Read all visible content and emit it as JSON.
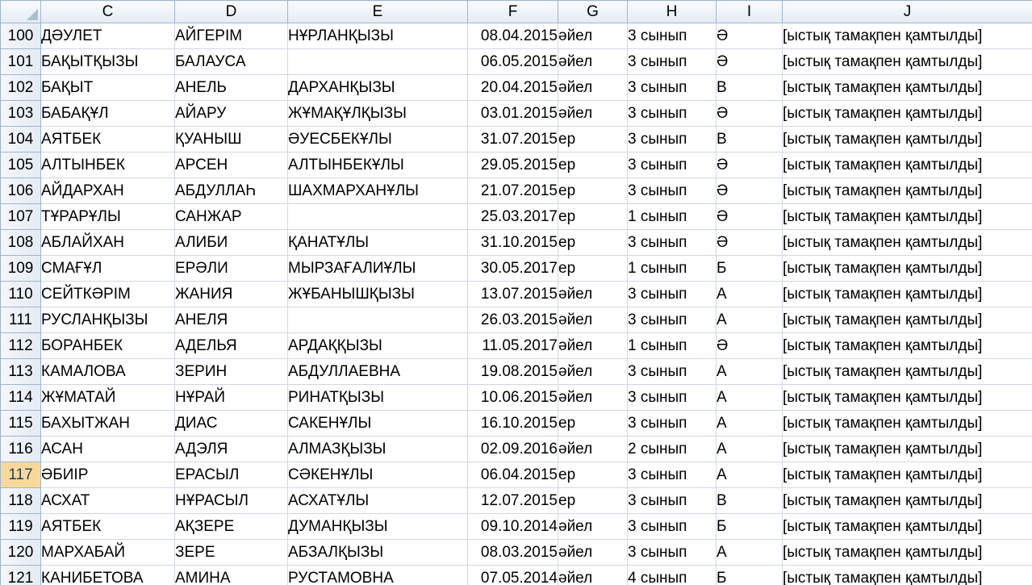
{
  "columns": [
    "C",
    "D",
    "E",
    "F",
    "G",
    "H",
    "I",
    "J"
  ],
  "active_row": "117",
  "rows": [
    {
      "n": "100",
      "c": "ДӘУЛЕТ",
      "d": "АЙГЕРІМ",
      "e": "НҰРЛАНҚЫЗЫ",
      "f": "08.04.2015",
      "g": "әйел",
      "h": "3 сынып",
      "i": "Ә",
      "j": "[ыстық тамақпен қамтылды]"
    },
    {
      "n": "101",
      "c": "БАҚЫТҚЫЗЫ",
      "d": "БАЛАУСА",
      "e": "",
      "f": "06.05.2015",
      "g": "әйел",
      "h": "3 сынып",
      "i": "Ә",
      "j": "[ыстық тамақпен қамтылды]"
    },
    {
      "n": "102",
      "c": "БАҚЫТ",
      "d": "АНЕЛЬ",
      "e": "ДАРХАНҚЫЗЫ",
      "f": "20.04.2015",
      "g": "әйел",
      "h": "3 сынып",
      "i": "В",
      "j": "[ыстық тамақпен қамтылды]"
    },
    {
      "n": "103",
      "c": "БАБАҚҰЛ",
      "d": "АЙАРУ",
      "e": "ЖҰМАҚҰЛҚЫЗЫ",
      "f": "03.01.2015",
      "g": "әйел",
      "h": "3 сынып",
      "i": "Ә",
      "j": "[ыстық тамақпен қамтылды]"
    },
    {
      "n": "104",
      "c": "АЯТБЕК",
      "d": "ҚУАНЫШ",
      "e": "ӘУЕСБЕКҰЛЫ",
      "f": "31.07.2015",
      "g": "ер",
      "h": "3 сынып",
      "i": "В",
      "j": "[ыстық тамақпен қамтылды]"
    },
    {
      "n": "105",
      "c": "АЛТЫНБЕК",
      "d": "АРСЕН",
      "e": "АЛТЫНБЕКҰЛЫ",
      "f": "29.05.2015",
      "g": "ер",
      "h": "3 сынып",
      "i": "Ә",
      "j": "[ыстық тамақпен қамтылды]"
    },
    {
      "n": "106",
      "c": "АЙДАРХАН",
      "d": "АБДУЛЛАҺ",
      "e": "ШАХМАРХАНҰЛЫ",
      "f": "21.07.2015",
      "g": "ер",
      "h": "3 сынып",
      "i": "Ә",
      "j": "[ыстық тамақпен қамтылды]"
    },
    {
      "n": "107",
      "c": "ТҰРАРҰЛЫ",
      "d": "САНЖАР",
      "e": "",
      "f": "25.03.2017",
      "g": "ер",
      "h": "1 сынып",
      "i": "Ә",
      "j": "[ыстық тамақпен қамтылды]"
    },
    {
      "n": "108",
      "c": "АБЛАЙХАН",
      "d": "АЛИБИ",
      "e": "ҚАНАТҰЛЫ",
      "f": "31.10.2015",
      "g": "ер",
      "h": "3 сынып",
      "i": "Ә",
      "j": "[ыстық тамақпен қамтылды]"
    },
    {
      "n": "109",
      "c": "СМАҒҰЛ",
      "d": "ЕРӘЛИ",
      "e": "МЫРЗАҒАЛИҰЛЫ",
      "f": "30.05.2017",
      "g": "ер",
      "h": "1 сынып",
      "i": "Б",
      "j": "[ыстық тамақпен қамтылды]"
    },
    {
      "n": "110",
      "c": "СЕЙТКӘРІМ",
      "d": "ЖАНИЯ",
      "e": "ЖҰБАНЫШҚЫЗЫ",
      "f": "13.07.2015",
      "g": "әйел",
      "h": "3 сынып",
      "i": "А",
      "j": "[ыстық тамақпен қамтылды]"
    },
    {
      "n": "111",
      "c": "РУСЛАНҚЫЗЫ",
      "d": "АНЕЛЯ",
      "e": "",
      "f": "26.03.2015",
      "g": "әйел",
      "h": "3 сынып",
      "i": "А",
      "j": "[ыстық тамақпен қамтылды]"
    },
    {
      "n": "112",
      "c": "БОРАНБЕК",
      "d": "АДЕЛЬЯ",
      "e": "АРДАҚҚЫЗЫ",
      "f": "11.05.2017",
      "g": "әйел",
      "h": "1 сынып",
      "i": "Ә",
      "j": "[ыстық тамақпен қамтылды]"
    },
    {
      "n": "113",
      "c": "КАМАЛОВА",
      "d": "ЗЕРИН",
      "e": "АБДУЛЛАЕВНА",
      "f": "19.08.2015",
      "g": "әйел",
      "h": "3 сынып",
      "i": "А",
      "j": "[ыстық тамақпен қамтылды]"
    },
    {
      "n": "114",
      "c": "ЖҰМАТАЙ",
      "d": "НҰРАЙ",
      "e": "РИНАТҚЫЗЫ",
      "f": "10.06.2015",
      "g": "әйел",
      "h": "3 сынып",
      "i": "А",
      "j": "[ыстық тамақпен қамтылды]"
    },
    {
      "n": "115",
      "c": "БАХЫТЖАН",
      "d": "ДИАС",
      "e": "САКЕНҰЛЫ",
      "f": "16.10.2015",
      "g": "ер",
      "h": "3 сынып",
      "i": "А",
      "j": "[ыстық тамақпен қамтылды]"
    },
    {
      "n": "116",
      "c": "АСАН",
      "d": "АДЭЛЯ",
      "e": "АЛМАЗҚЫЗЫ",
      "f": "02.09.2016",
      "g": "әйел",
      "h": "2 сынып",
      "i": "А",
      "j": "[ыстық тамақпен қамтылды]"
    },
    {
      "n": "117",
      "c": "ӘБИІР",
      "d": "ЕРАСЫЛ",
      "e": "СӘКЕНҰЛЫ",
      "f": "06.04.2015",
      "g": "ер",
      "h": "3 сынып",
      "i": "А",
      "j": "[ыстық тамақпен қамтылды]"
    },
    {
      "n": "118",
      "c": "АСХАТ",
      "d": "НҰРАСЫЛ",
      "e": "АСХАТҰЛЫ",
      "f": "12.07.2015",
      "g": "ер",
      "h": "3 сынып",
      "i": "В",
      "j": "[ыстық тамақпен қамтылды]"
    },
    {
      "n": "119",
      "c": "АЯТБЕК",
      "d": "АҚЗЕРЕ",
      "e": "ДУМАНҚЫЗЫ",
      "f": "09.10.2014",
      "g": "әйел",
      "h": "3 сынып",
      "i": "Б",
      "j": "[ыстық тамақпен қамтылды]"
    },
    {
      "n": "120",
      "c": "МАРХАБАЙ",
      "d": "ЗЕРЕ",
      "e": "АБЗАЛҚЫЗЫ",
      "f": "08.03.2015",
      "g": "әйел",
      "h": "3 сынып",
      "i": "А",
      "j": "[ыстық тамақпен қамтылды]"
    },
    {
      "n": "121",
      "c": "КАНИБЕТОВА",
      "d": "АМИНА",
      "e": "РУСТАМОВНА",
      "f": "07.05.2014",
      "g": "әйел",
      "h": "4 сынып",
      "i": "Б",
      "j": "[ыстық тамақпен қамтылды]"
    }
  ]
}
